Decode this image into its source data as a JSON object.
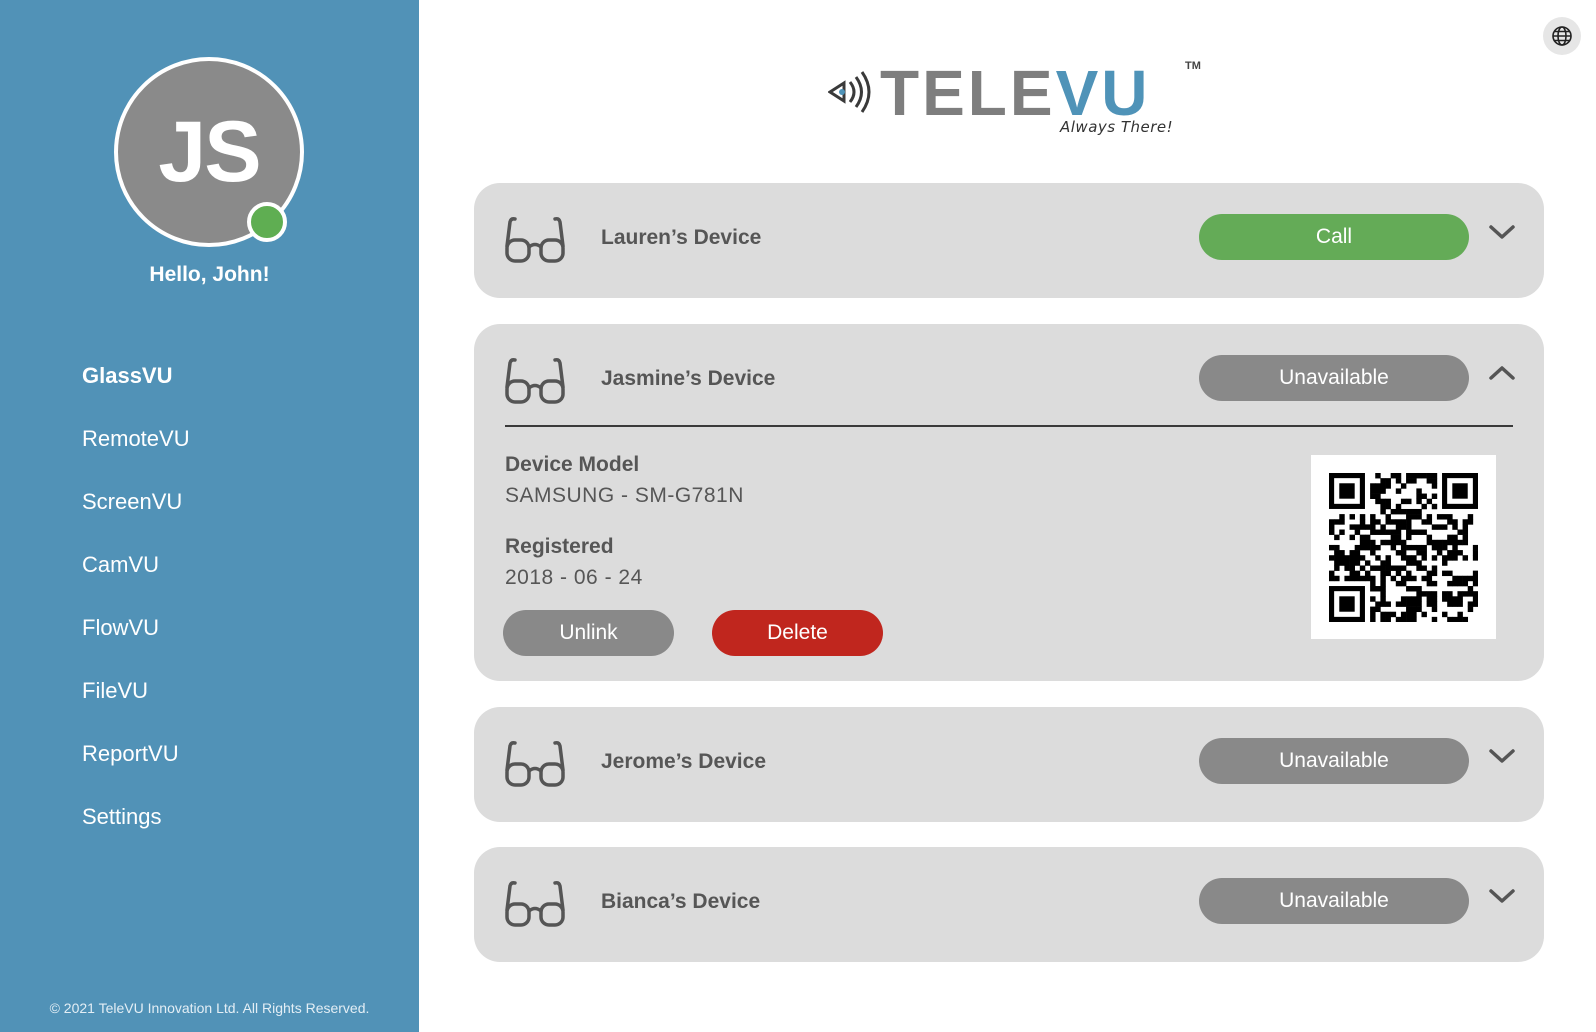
{
  "sidebar": {
    "avatar_initials": "JS",
    "greeting": "Hello, John!",
    "nav": [
      {
        "label": "GlassVU",
        "active": true
      },
      {
        "label": "RemoteVU"
      },
      {
        "label": "ScreenVU"
      },
      {
        "label": "CamVU"
      },
      {
        "label": "FlowVU"
      },
      {
        "label": "FileVU"
      },
      {
        "label": "ReportVU"
      },
      {
        "label": "Settings"
      }
    ],
    "copyright": "© 2021 TeleVU Innovation Ltd. All Rights Reserved."
  },
  "header": {
    "globe_icon": "globe-icon",
    "logo": {
      "part1": "TELE",
      "part2": "VU",
      "tm": "TM",
      "tagline": "Always There!"
    }
  },
  "devices": [
    {
      "name": "Lauren’s Device",
      "status": "Call",
      "status_kind": "call",
      "expanded": false,
      "icon": "glasses-icon"
    },
    {
      "name": "Jasmine’s Device",
      "status": "Unavailable",
      "status_kind": "unavailable",
      "expanded": true,
      "icon": "glasses-icon",
      "details": {
        "model_label": "Device Model",
        "model_value": "SAMSUNG - SM-G781N",
        "registered_label": "Registered",
        "registered_value": "2018 - 06 - 24",
        "unlink_label": "Unlink",
        "delete_label": "Delete"
      }
    },
    {
      "name": "Jerome’s Device",
      "status": "Unavailable",
      "status_kind": "unavailable",
      "expanded": false,
      "icon": "glasses-icon"
    },
    {
      "name": "Bianca’s Device",
      "status": "Unavailable",
      "status_kind": "unavailable",
      "expanded": false,
      "icon": "glasses-icon"
    }
  ],
  "colors": {
    "sidebar": "#5192b7",
    "online": "#5fae52",
    "call": "#64ab57",
    "unavailable": "#898989",
    "delete": "#c0261e",
    "card": "#dcdcdc"
  }
}
